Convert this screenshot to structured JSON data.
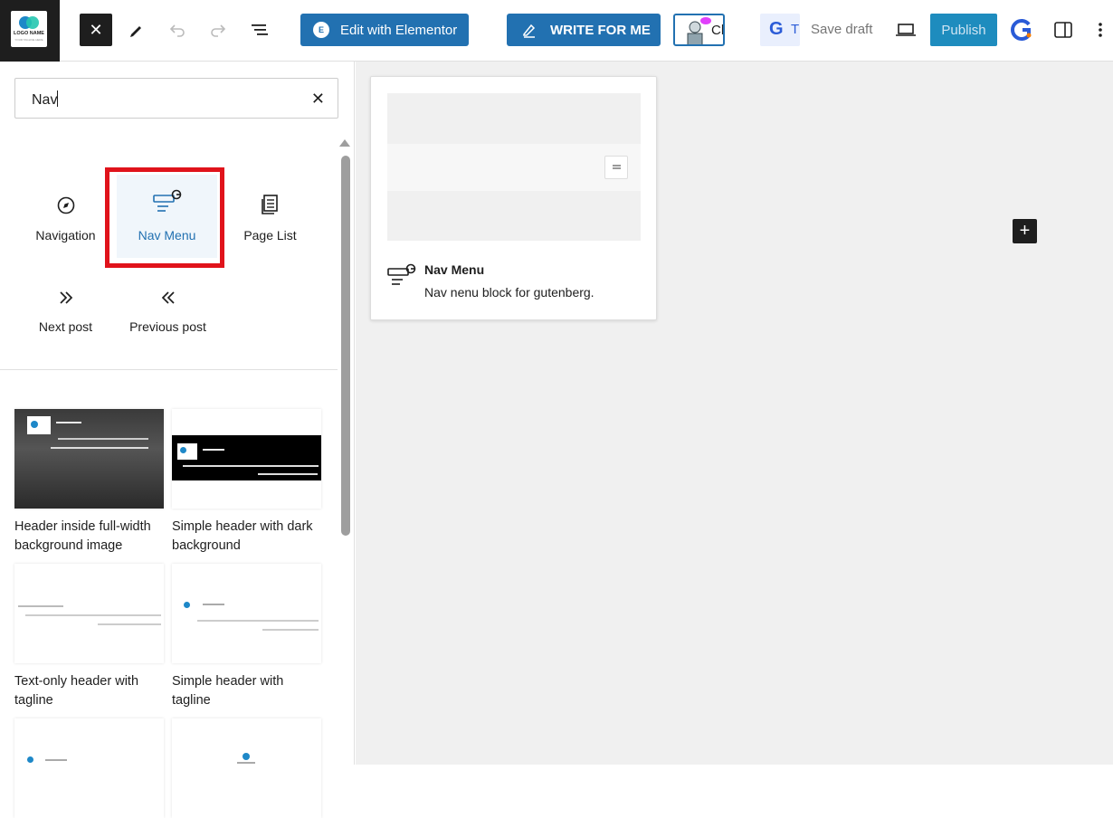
{
  "topbar": {
    "logo_text": "LOGO NAME",
    "logo_sub": "YOUR TAGLINE HERE",
    "elementor_label": "Edit with Elementor",
    "elementor_badge": "E",
    "write_for_me_label": "WRITE FOR ME",
    "ch_label": "Ch",
    "tg_letter": "G",
    "tg_label": "T",
    "save_draft_label": "Save draft",
    "publish_label": "Publish"
  },
  "search": {
    "value": "Nav"
  },
  "blocks": [
    {
      "label": "Navigation",
      "icon": "compass-icon"
    },
    {
      "label": "Nav Menu",
      "icon": "nav-menu-icon",
      "selected": true
    },
    {
      "label": "Page List",
      "icon": "page-list-icon"
    },
    {
      "label": "Next post",
      "icon": "chevron-double-right-icon"
    },
    {
      "label": "Previous post",
      "icon": "chevron-double-left-icon"
    }
  ],
  "patterns": [
    {
      "label": "Header inside full-width background image"
    },
    {
      "label": "Simple header with dark background"
    },
    {
      "label": "Text-only header with tagline"
    },
    {
      "label": "Simple header with tagline"
    }
  ],
  "preview": {
    "title": "Nav Menu",
    "description": "Nav nenu block for gutenberg."
  },
  "colors": {
    "accent": "#2271b1",
    "highlight": "#e0131b",
    "dark": "#1e1e1e"
  }
}
